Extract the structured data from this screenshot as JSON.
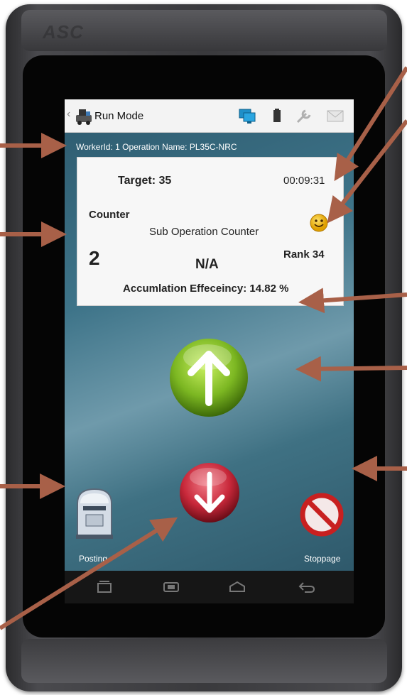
{
  "device": {
    "engraving": "ASC"
  },
  "topbar": {
    "title": "Run Mode",
    "icons": [
      "back-chevron-icon",
      "machine-icon",
      "monitor-icon",
      "battery-icon",
      "wrench-icon",
      "mail-icon"
    ]
  },
  "info": {
    "line": "WorkerId: 1 Operation Name: PL35C-NRC"
  },
  "panel": {
    "target": "Target: 35",
    "timer": "00:09:31",
    "counter_label": "Counter",
    "sub_operation": "Sub Operation Counter",
    "count": "2",
    "na": "N/A",
    "rank": "Rank 34",
    "accumulation": "Accumlation Effeceincy: 14.82 %"
  },
  "actions": {
    "posting_label": "Posting",
    "stoppage_label": "Stoppage"
  },
  "navbar": {
    "icons": [
      "recent-apps-icon",
      "home-icon",
      "home-outline-icon",
      "back-icon"
    ]
  },
  "colors": {
    "arrow": "#a86048",
    "up_button": "#7cb722",
    "down_button": "#c8283a",
    "stop": "#c82020"
  }
}
